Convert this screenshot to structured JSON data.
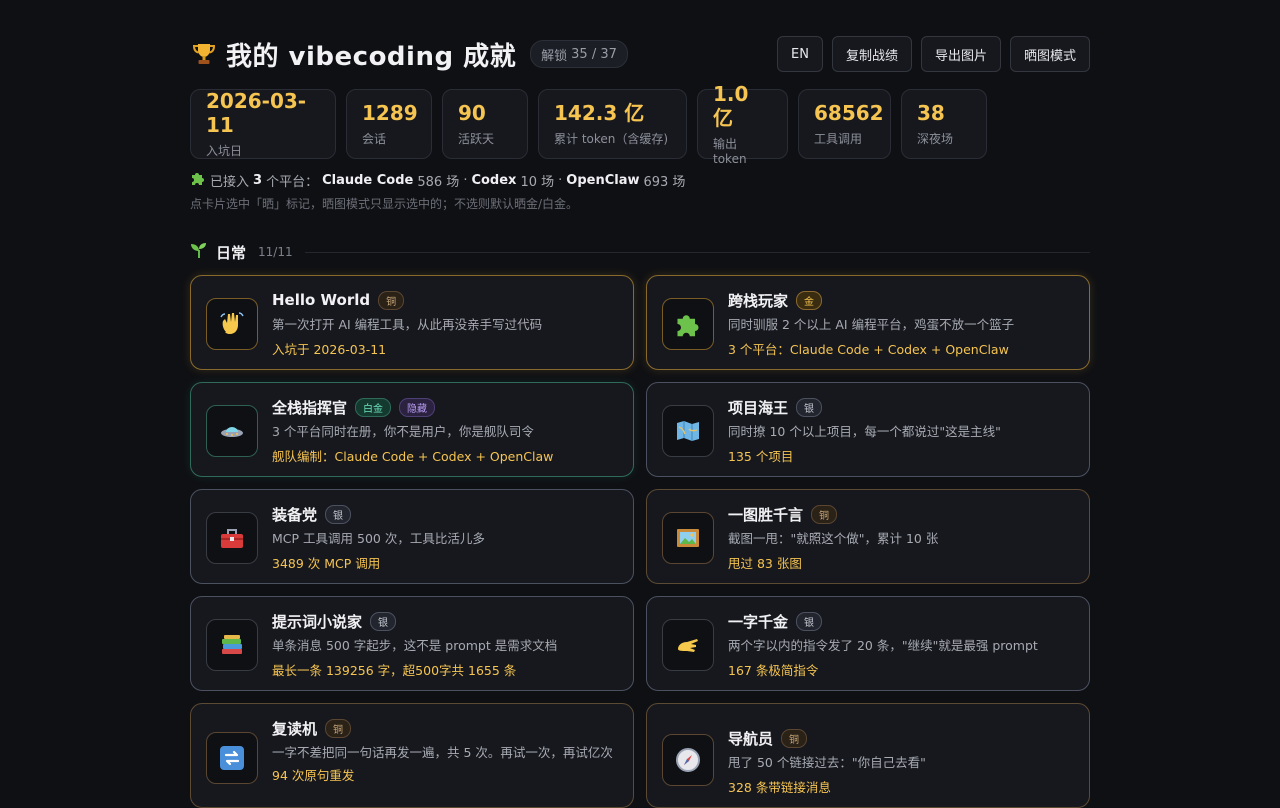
{
  "header": {
    "title": "我的 vibecoding 成就",
    "unlock_label": "解锁",
    "unlock_count": "35 / 37",
    "actions": [
      "EN",
      "复制战绩",
      "导出图片",
      "晒图模式"
    ]
  },
  "stats": [
    {
      "value": "2026-03-11",
      "label": "入坑日"
    },
    {
      "value": "1289",
      "label": "会话"
    },
    {
      "value": "90",
      "label": "活跃天"
    },
    {
      "value": "142.3 亿",
      "label": "累计 token（含缓存)"
    },
    {
      "value": "1.0 亿",
      "label": "输出 token"
    },
    {
      "value": "68562",
      "label": "工具调用"
    },
    {
      "value": "38",
      "label": "深夜场"
    }
  ],
  "platforms": {
    "prefix": "已接入",
    "count": "3",
    "suffix": "个平台：",
    "items": [
      {
        "name": "Claude Code",
        "sessions": "586 场"
      },
      {
        "name": "Codex",
        "sessions": "10 场"
      },
      {
        "name": "OpenClaw",
        "sessions": "693 场"
      }
    ],
    "sep": "·"
  },
  "hint": "点卡片选中「晒」标记，晒图模式只显示选中的；不选则默认晒金/白金。",
  "section": {
    "title": "日常",
    "count": "11/11"
  },
  "cards": [
    {
      "icon": "waving-hand",
      "name": "Hello World",
      "badges": [
        {
          "tier": "bronze",
          "label": "铜"
        }
      ],
      "desc": "第一次打开 AI 编程工具，从此再没亲手写过代码",
      "stat": "入坑于 2026-03-11",
      "tier": "gold"
    },
    {
      "icon": "puzzle-piece",
      "name": "跨栈玩家",
      "badges": [
        {
          "tier": "gold",
          "label": "金"
        }
      ],
      "desc": "同时驯服 2 个以上 AI 编程平台，鸡蛋不放一个篮子",
      "stat": "3 个平台：Claude Code + Codex + OpenClaw",
      "tier": "gold"
    },
    {
      "icon": "flying-saucer",
      "name": "全栈指挥官",
      "badges": [
        {
          "tier": "plat",
          "label": "白金"
        },
        {
          "tier": "hidden",
          "label": "隐藏"
        }
      ],
      "desc": "3 个平台同时在册，你不是用户，你是舰队司令",
      "stat": "舰队编制：Claude Code + Codex + OpenClaw",
      "tier": "plat"
    },
    {
      "icon": "map",
      "name": "项目海王",
      "badges": [
        {
          "tier": "silver",
          "label": "银"
        }
      ],
      "desc": "同时撩 10 个以上项目，每一个都说过\"这是主线\"",
      "stat": "135 个项目",
      "tier": "silver"
    },
    {
      "icon": "toolbox",
      "name": "装备党",
      "badges": [
        {
          "tier": "silver",
          "label": "银"
        }
      ],
      "desc": "MCP 工具调用 500 次，工具比活儿多",
      "stat": "3489 次 MCP 调用",
      "tier": "silver"
    },
    {
      "icon": "framed-picture",
      "name": "一图胜千言",
      "badges": [
        {
          "tier": "bronze",
          "label": "铜"
        }
      ],
      "desc": "截图一甩：\"就照这个做\"，累计 10 张",
      "stat": "甩过 83 张图",
      "tier": "bronze"
    },
    {
      "icon": "books",
      "name": "提示词小说家",
      "badges": [
        {
          "tier": "silver",
          "label": "银"
        }
      ],
      "desc": "单条消息 500 字起步，这不是 prompt 是需求文档",
      "stat": "最长一条 139256 字，超500字共 1655 条",
      "tier": "silver"
    },
    {
      "icon": "pinching-hand",
      "name": "一字千金",
      "badges": [
        {
          "tier": "silver",
          "label": "银"
        }
      ],
      "desc": "两个字以内的指令发了 20 条，\"继续\"就是最强 prompt",
      "stat": "167 条极简指令",
      "tier": "silver"
    },
    {
      "icon": "repeat",
      "name": "复读机",
      "badges": [
        {
          "tier": "bronze",
          "label": "铜"
        }
      ],
      "desc": "一字不差把同一句话再发一遍，共 5 次。再试一次，再试亿次",
      "stat": "94 次原句重发",
      "tier": "bronze"
    },
    {
      "icon": "compass",
      "name": "导航员",
      "badges": [
        {
          "tier": "bronze",
          "label": "铜"
        }
      ],
      "desc": "甩了 50 个链接过去：\"你自己去看\"",
      "stat": "328 条带链接消息",
      "tier": "bronze"
    }
  ]
}
